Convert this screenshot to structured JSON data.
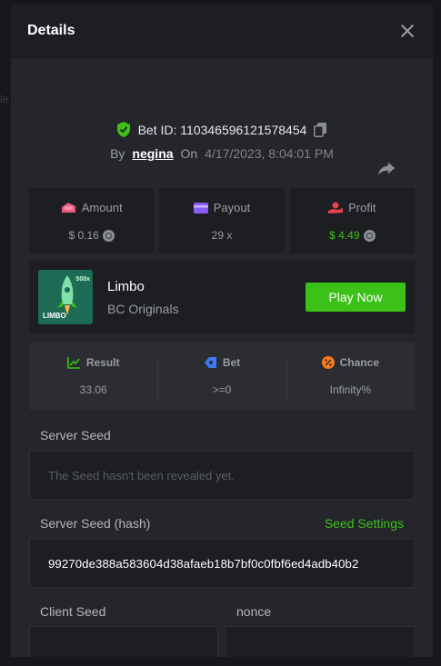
{
  "modal": {
    "title": "Details"
  },
  "bet": {
    "id_label": "Bet ID: 110346596121578454",
    "by_label": "By",
    "user": "negina",
    "on_label": "On",
    "date": "4/17/2023, 8:04:01 PM"
  },
  "stats": [
    {
      "label": "Amount",
      "value": "$ 0.16",
      "icon": "amount-icon"
    },
    {
      "label": "Payout",
      "value": "29 x",
      "icon": "payout-icon"
    },
    {
      "label": "Profit",
      "value": "$ 4.49",
      "icon": "profit-icon"
    }
  ],
  "game": {
    "name": "Limbo",
    "provider": "BC Originals",
    "play_label": "Play Now",
    "thumb_text": "LIMBO",
    "thumb_badge": "500x"
  },
  "results": [
    {
      "label": "Result",
      "value": "33.06"
    },
    {
      "label": "Bet",
      "value": ">=0"
    },
    {
      "label": "Chance",
      "value": "Infinity%"
    }
  ],
  "server_seed": {
    "label": "Server Seed",
    "placeholder": "The Seed hasn't been revealed yet."
  },
  "server_hash": {
    "label": "Server Seed (hash)",
    "settings_label": "Seed Settings",
    "value": "99270de388a583604d38afaeb18b7bf0c0fbf6ed4adb40b2"
  },
  "client_seed": {
    "label": "Client Seed"
  },
  "nonce": {
    "label": "nonce"
  },
  "colors": {
    "accent_green": "#3bc117",
    "panel": "#24262b",
    "card": "#1c1e22"
  }
}
